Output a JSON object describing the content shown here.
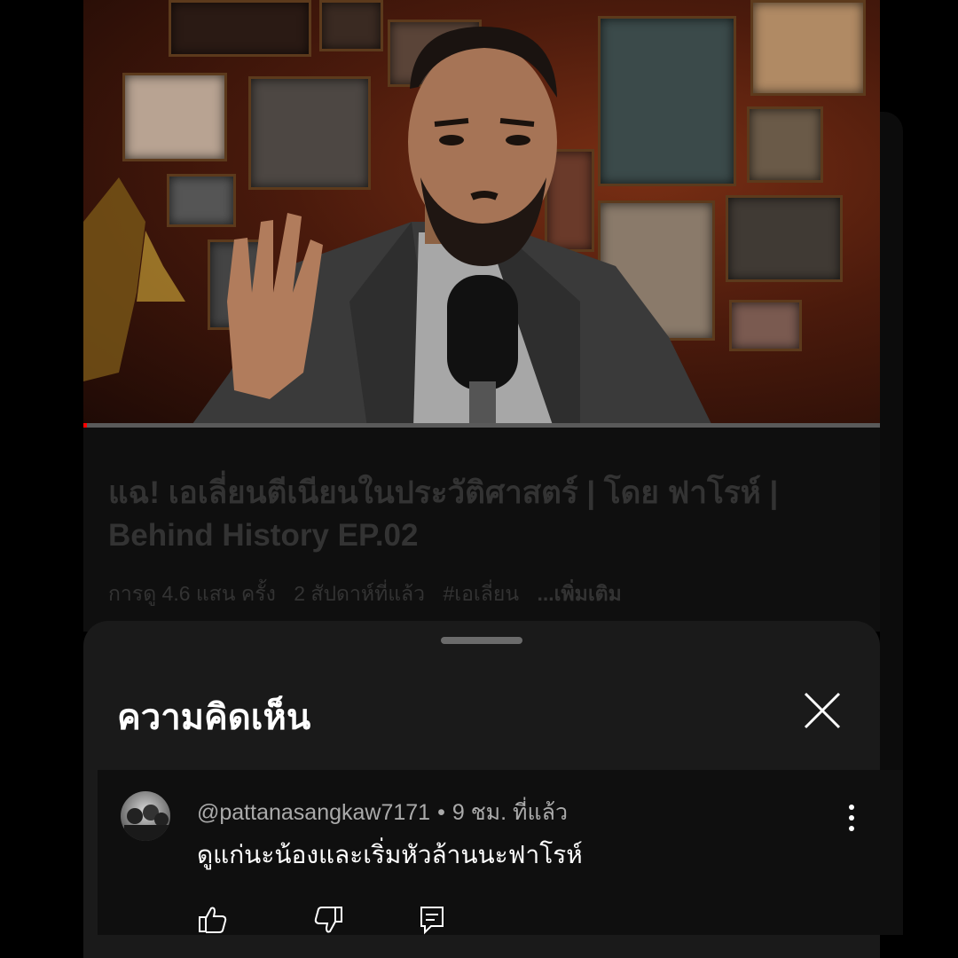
{
  "video": {
    "title": "แฉ! เอเลี่ยนตีเนียนในประวัติศาสตร์ | โดย ฟาโรห์ | Behind History EP.02",
    "views": "การดู 4.6 แสน ครั้ง",
    "uploaded": "2 สัปดาห์ที่แล้ว",
    "hashtag": "#เอเลี่ยน",
    "more_label": "...เพิ่มเติม",
    "progress_fraction": 0.004
  },
  "comments_panel": {
    "title": "ความคิดเห็น",
    "close_icon": "close-icon"
  },
  "comments": [
    {
      "author": "@pattanasangkaw7171",
      "separator": "•",
      "time": "9 ชม. ที่แล้ว",
      "text": "ดูแก่นะน้องและเริ่มหัวล้านนะฟาโรห์",
      "actions": [
        "like-icon",
        "dislike-icon",
        "reply-icon"
      ]
    }
  ],
  "colors": {
    "background": "#000000",
    "sheet": "#1a1a1a",
    "muted_text": "#aaaaaa",
    "progress": "#ff0000"
  }
}
